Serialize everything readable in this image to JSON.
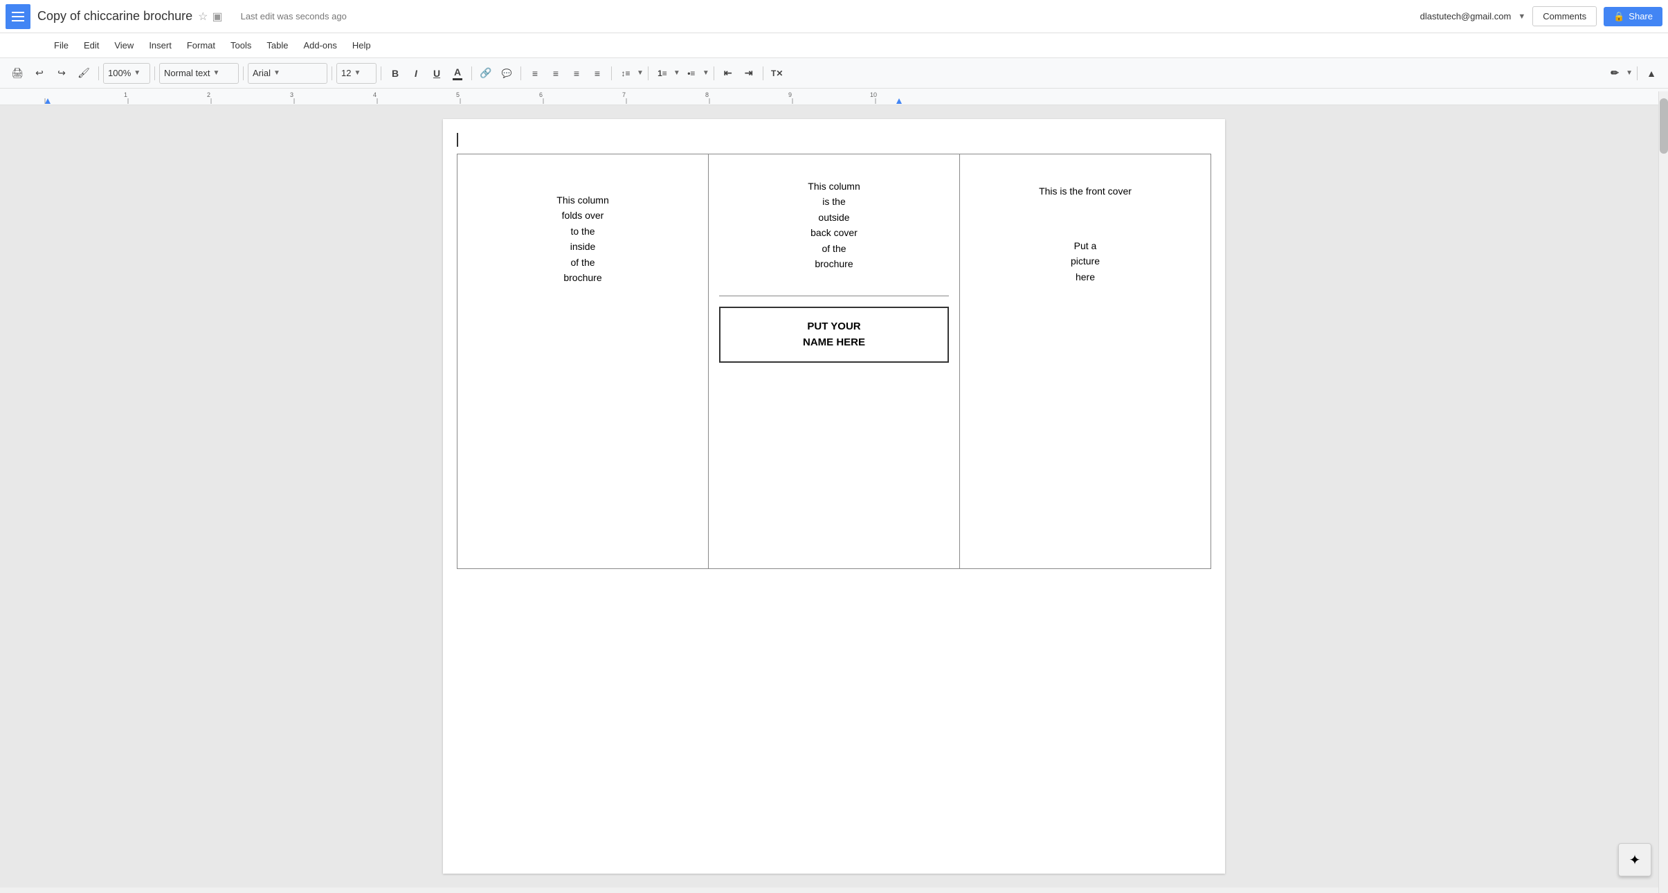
{
  "header": {
    "app_icon": "≡",
    "title": "Copy of chiccarine brochure",
    "star": "☆",
    "folder": "▣",
    "last_edit": "Last edit was seconds ago",
    "user_email": "dlastutech@gmail.com",
    "comments_label": "Comments",
    "share_label": "Share",
    "share_icon": "🔒"
  },
  "menu": {
    "items": [
      "File",
      "Edit",
      "View",
      "Insert",
      "Format",
      "Tools",
      "Table",
      "Add-ons",
      "Help"
    ]
  },
  "toolbar": {
    "zoom": "100%",
    "style": "Normal text",
    "font": "Arial",
    "size": "12",
    "bold": "B",
    "italic": "I",
    "underline": "U",
    "text_color": "A"
  },
  "document": {
    "col1_text": "This column\nfolds over\nto the\ninside\nof the\nbrochure",
    "col2_top_text": "This column\nis the\noutside\nback cover\nof the\nbrochure",
    "col2_name_text": "PUT YOUR\nNAME HERE",
    "col3_top_text": "This is the front cover",
    "col3_picture_text": "Put a\npicture\nhere"
  }
}
